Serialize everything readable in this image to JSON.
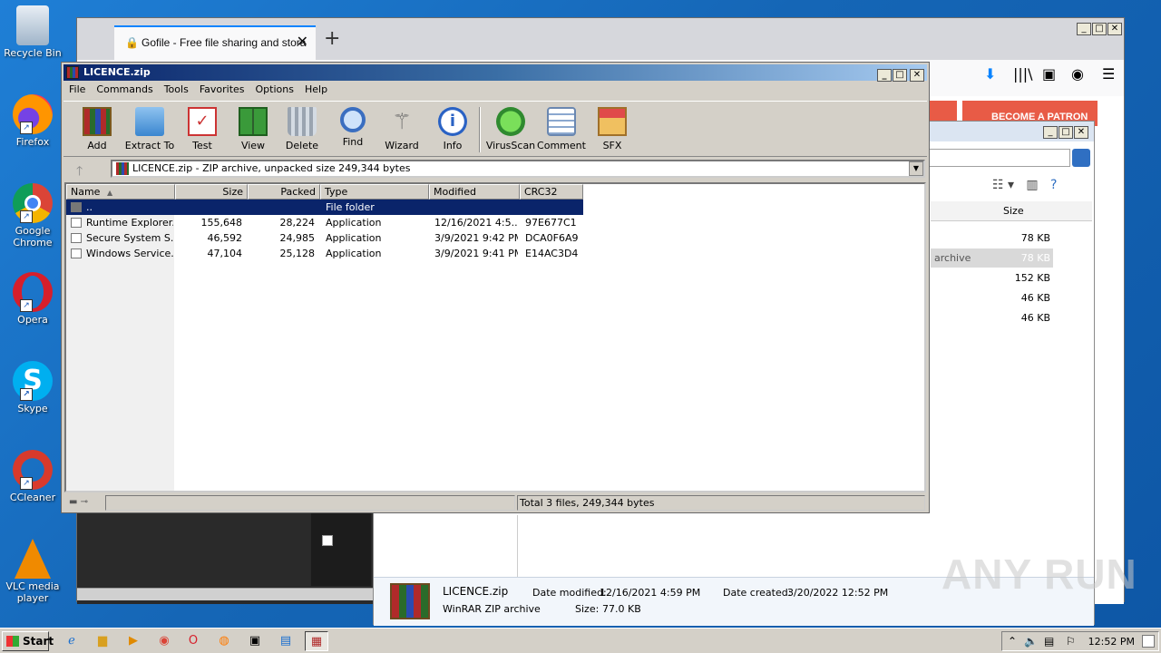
{
  "desktop": {
    "icons": [
      {
        "label": "Recycle Bin",
        "icon": "recycle-bin"
      },
      {
        "label": "Firefox",
        "icon": "firefox"
      },
      {
        "label": "Google Chrome",
        "icon": "chrome"
      },
      {
        "label": "Opera",
        "icon": "opera"
      },
      {
        "label": "Skype",
        "icon": "skype"
      },
      {
        "label": "CCleaner",
        "icon": "ccleaner"
      },
      {
        "label": "VLC media player",
        "icon": "vlc"
      }
    ]
  },
  "firefox": {
    "tab_title": "Gofile - Free file sharing and stora",
    "patron_button": "BECOME A PATRON",
    "colors": {
      "accent": "#0a84ff",
      "patron": "#e85b46"
    }
  },
  "explorer": {
    "col_size": "Size",
    "sizes": [
      "78 KB",
      "78 KB",
      "152 KB",
      "46 KB",
      "46 KB"
    ],
    "selected_fragment": "archive",
    "details": {
      "name": "LICENCE.zip",
      "type": "WinRAR ZIP archive",
      "date_modified_label": "Date modified:",
      "date_modified": "12/16/2021 4:59 PM",
      "size_label": "Size:",
      "size": "77.0 KB",
      "date_created_label": "Date created:",
      "date_created": "3/20/2022 12:52 PM"
    }
  },
  "winrar": {
    "title": "LICENCE.zip",
    "menu": [
      "File",
      "Commands",
      "Tools",
      "Favorites",
      "Options",
      "Help"
    ],
    "toolbar": [
      "Add",
      "Extract To",
      "Test",
      "View",
      "Delete",
      "Find",
      "Wizard",
      "Info",
      "VirusScan",
      "Comment",
      "SFX"
    ],
    "path": "LICENCE.zip - ZIP archive, unpacked size 249,344 bytes",
    "columns": [
      "Name",
      "Size",
      "Packed",
      "Type",
      "Modified",
      "CRC32"
    ],
    "rows": [
      {
        "name": "..",
        "size": "",
        "packed": "",
        "type": "File folder",
        "modified": "",
        "crc": "",
        "selected": true
      },
      {
        "name": "Runtime Explorer...",
        "size": "155,648",
        "packed": "28,224",
        "type": "Application",
        "modified": "12/16/2021 4:5...",
        "crc": "97E677C1"
      },
      {
        "name": "Secure System S...",
        "size": "46,592",
        "packed": "24,985",
        "type": "Application",
        "modified": "3/9/2021 9:42 PM",
        "crc": "DCA0F6A9"
      },
      {
        "name": "Windows Service...",
        "size": "47,104",
        "packed": "25,128",
        "type": "Application",
        "modified": "3/9/2021 9:41 PM",
        "crc": "E14AC3D4"
      }
    ],
    "status": "Total 3 files, 249,344 bytes",
    "colors": {
      "title_start": "#0a246a",
      "selection": "#0a246a"
    }
  },
  "taskbar": {
    "start_label": "Start",
    "clock": "12:52 PM"
  },
  "watermark": "ANY RUN"
}
